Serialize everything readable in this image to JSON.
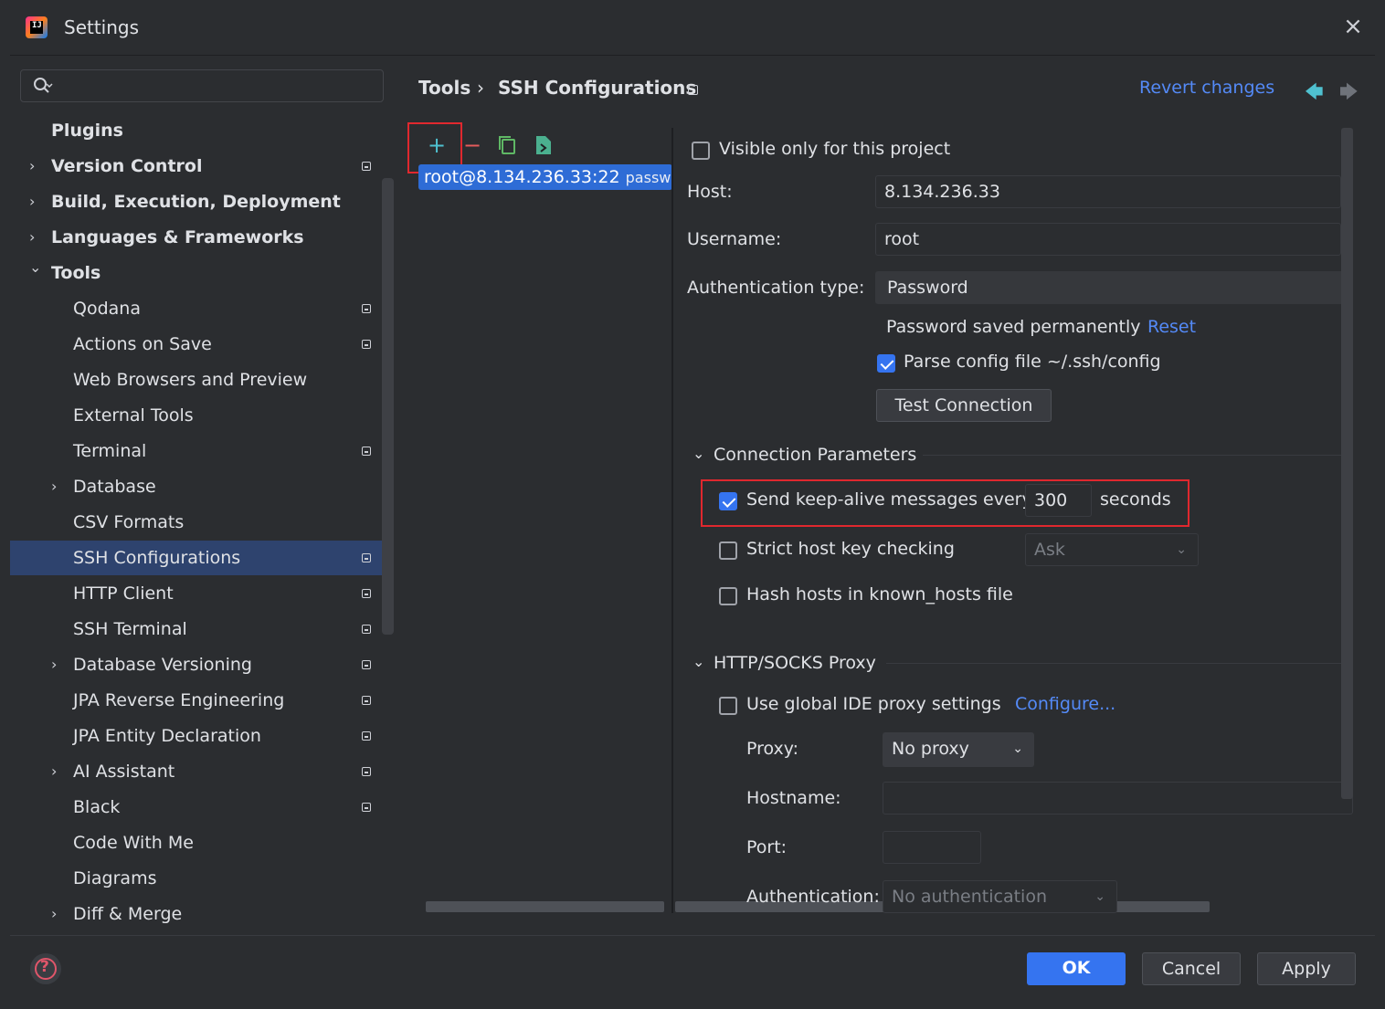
{
  "window": {
    "title": "Settings",
    "close_icon": "×",
    "logo_text": "IJ"
  },
  "colors": {
    "accent": "#3574f0",
    "link": "#548af7",
    "highlight_frame": "#e0282e",
    "selection": "#2e436e"
  },
  "search": {
    "placeholder": ""
  },
  "nav": [
    {
      "label": "Plugins",
      "expandable": false,
      "pinned": false,
      "bold": true,
      "indent": 1
    },
    {
      "label": "Version Control",
      "expandable": true,
      "pinned": true,
      "bold": true,
      "indent": 1
    },
    {
      "label": "Build, Execution, Deployment",
      "expandable": true,
      "pinned": false,
      "bold": true,
      "indent": 1
    },
    {
      "label": "Languages & Frameworks",
      "expandable": true,
      "pinned": false,
      "bold": true,
      "indent": 1
    },
    {
      "label": "Tools",
      "expandable": true,
      "expanded": true,
      "pinned": false,
      "bold": true,
      "indent": 1
    },
    {
      "label": "Qodana",
      "expandable": false,
      "pinned": true,
      "bold": false,
      "indent": 2
    },
    {
      "label": "Actions on Save",
      "expandable": false,
      "pinned": true,
      "bold": false,
      "indent": 2
    },
    {
      "label": "Web Browsers and Preview",
      "expandable": false,
      "pinned": false,
      "bold": false,
      "indent": 2
    },
    {
      "label": "External Tools",
      "expandable": false,
      "pinned": false,
      "bold": false,
      "indent": 2
    },
    {
      "label": "Terminal",
      "expandable": false,
      "pinned": true,
      "bold": false,
      "indent": 2
    },
    {
      "label": "Database",
      "expandable": true,
      "pinned": false,
      "bold": false,
      "indent": 2
    },
    {
      "label": "CSV Formats",
      "expandable": false,
      "pinned": false,
      "bold": false,
      "indent": 2
    },
    {
      "label": "SSH Configurations",
      "expandable": false,
      "pinned": true,
      "bold": false,
      "indent": 2,
      "selected": true
    },
    {
      "label": "HTTP Client",
      "expandable": false,
      "pinned": true,
      "bold": false,
      "indent": 2
    },
    {
      "label": "SSH Terminal",
      "expandable": false,
      "pinned": true,
      "bold": false,
      "indent": 2
    },
    {
      "label": "Database Versioning",
      "expandable": true,
      "pinned": true,
      "bold": false,
      "indent": 2
    },
    {
      "label": "JPA Reverse Engineering",
      "expandable": false,
      "pinned": true,
      "bold": false,
      "indent": 2
    },
    {
      "label": "JPA Entity Declaration",
      "expandable": false,
      "pinned": true,
      "bold": false,
      "indent": 2
    },
    {
      "label": "AI Assistant",
      "expandable": true,
      "pinned": true,
      "bold": false,
      "indent": 2
    },
    {
      "label": "Black",
      "expandable": false,
      "pinned": true,
      "bold": false,
      "indent": 2
    },
    {
      "label": "Code With Me",
      "expandable": false,
      "pinned": false,
      "bold": false,
      "indent": 2
    },
    {
      "label": "Diagrams",
      "expandable": false,
      "pinned": false,
      "bold": false,
      "indent": 2
    },
    {
      "label": "Diff & Merge",
      "expandable": true,
      "pinned": false,
      "bold": false,
      "indent": 2
    }
  ],
  "breadcrumb": {
    "parent": "Tools",
    "separator": "›",
    "current": "SSH Configurations",
    "revert": "Revert changes",
    "back_icon": "🡄",
    "forward_icon": "🡆"
  },
  "toolbar": {
    "add_icon": "+",
    "remove_icon": "−"
  },
  "ssh_list": {
    "item_host": "root@8.134.236.33:22",
    "item_auth": "password"
  },
  "form": {
    "visible_only": "Visible only for this project",
    "host_label": "Host:",
    "host_value": "8.134.236.33",
    "username_label": "Username:",
    "username_value": "root",
    "auth_type_label": "Authentication type:",
    "auth_type_value": "Password",
    "password_saved": "Password saved permanently",
    "reset": "Reset",
    "parse_config": "Parse config file ~/.ssh/config",
    "test_connection": "Test Connection"
  },
  "connection_params": {
    "header": "Connection Parameters",
    "keepalive_label": "Send keep-alive messages every",
    "keepalive_value": "300",
    "keepalive_unit": "seconds",
    "strict_host_key": "Strict host key checking",
    "strict_value": "Ask",
    "hash_hosts": "Hash hosts in known_hosts file"
  },
  "proxy": {
    "header": "HTTP/SOCKS Proxy",
    "use_global": "Use global IDE proxy settings",
    "configure": "Configure...",
    "proxy_label": "Proxy:",
    "proxy_value": "No proxy",
    "hostname_label": "Hostname:",
    "port_label": "Port:",
    "auth_label": "Authentication:",
    "auth_value": "No authentication"
  },
  "footer": {
    "ok": "OK",
    "cancel": "Cancel",
    "apply": "Apply",
    "help_icon": "?"
  }
}
